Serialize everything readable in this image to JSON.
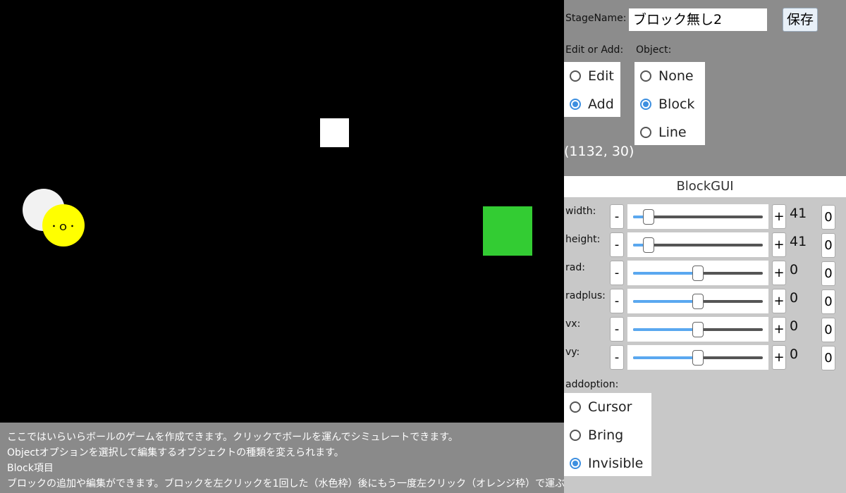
{
  "canvas": {
    "ball_face": "･ｏ･"
  },
  "info": {
    "lines": [
      "ここではいらいらボールのゲームを作成できます。クリックでボールを運んでシミュレートできます。",
      "Objectオプションを選択して編集するオブジェクトの種類を変えられます。",
      "Block項目",
      "ブロックの追加や編集ができます。ブロックを左クリックを1回した（水色枠）後にもう一度左クリック（オレンジ枠）で運ぶことができます"
    ]
  },
  "stage": {
    "label": "StageName:",
    "value": "ブロック無し2",
    "save_label": "保存"
  },
  "edit_or_add": {
    "label": "Edit or Add:",
    "options": [
      "Edit",
      "Add"
    ],
    "selected": "Add"
  },
  "object": {
    "label": "Object:",
    "options": [
      "None",
      "Block",
      "Line"
    ],
    "selected": "Block"
  },
  "coords": "(1132, 30)",
  "block_gui": {
    "title": "BlockGUI",
    "rows": [
      {
        "label": "width:",
        "value": "41",
        "fraction": 0.12,
        "reset": "0"
      },
      {
        "label": "height:",
        "value": "41",
        "fraction": 0.12,
        "reset": "0"
      },
      {
        "label": "rad:",
        "value": "0",
        "fraction": 0.5,
        "reset": "0"
      },
      {
        "label": "radplus:",
        "value": "0",
        "fraction": 0.5,
        "reset": "0"
      },
      {
        "label": "vx:",
        "value": "0",
        "fraction": 0.5,
        "reset": "0"
      },
      {
        "label": "vy:",
        "value": "0",
        "fraction": 0.5,
        "reset": "0"
      }
    ],
    "minus": "-",
    "plus": "+"
  },
  "addoption": {
    "label": "addoption:",
    "options": [
      "Cursor",
      "Bring",
      "Invisible"
    ],
    "selected": "Invisible"
  },
  "colors": {
    "accent": "#3d8fe0",
    "block_green": "#33cc33",
    "ball_yellow": "#ffff00"
  }
}
